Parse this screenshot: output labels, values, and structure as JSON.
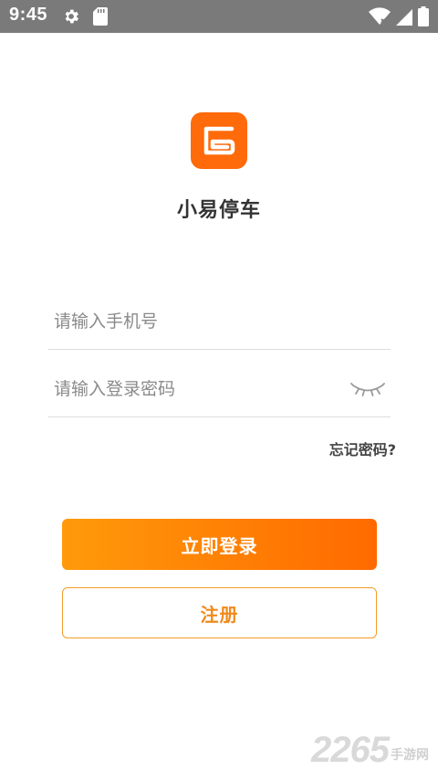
{
  "status_bar": {
    "time": "9:45",
    "icons": [
      "gear-icon",
      "sd-card-icon",
      "wifi-icon",
      "signal-icon",
      "battery-icon"
    ]
  },
  "app": {
    "name": "小易停车",
    "logo_color": "#ff6a0a"
  },
  "login": {
    "phone_placeholder": "请输入手机号",
    "phone_value": "",
    "password_placeholder": "请输入登录密码",
    "password_value": "",
    "forgot_label": "忘记密码?",
    "login_button": "立即登录",
    "register_button": "注册"
  },
  "watermark": {
    "number": "2265",
    "text": "手游网"
  },
  "colors": {
    "accent": "#ff7a0a",
    "status_bar": "#7a7a7a"
  }
}
